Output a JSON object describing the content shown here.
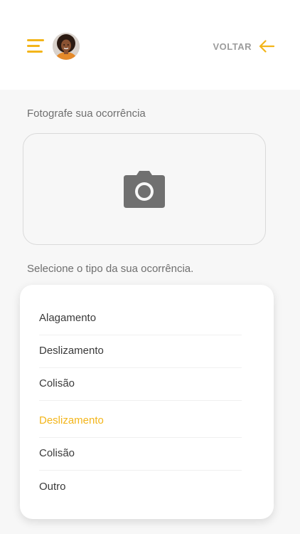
{
  "header": {
    "back_label": "VOLTAR"
  },
  "photo": {
    "label": "Fotografe sua ocorrência"
  },
  "occurrence": {
    "label": "Selecione o tipo da sua ocorrência.",
    "options": [
      {
        "label": "Alagamento"
      },
      {
        "label": "Deslizamento"
      },
      {
        "label": "Colisão"
      },
      {
        "label": "Deslizamento"
      },
      {
        "label": "Colisão"
      },
      {
        "label": "Outro"
      }
    ],
    "selected_index": 3
  },
  "colors": {
    "accent": "#f3b51a",
    "text_muted": "#6f6f6f",
    "camera_gray": "#707070"
  },
  "icons": {
    "menu": "hamburger-menu-icon",
    "back": "arrow-left-icon",
    "photo": "camera-icon"
  }
}
